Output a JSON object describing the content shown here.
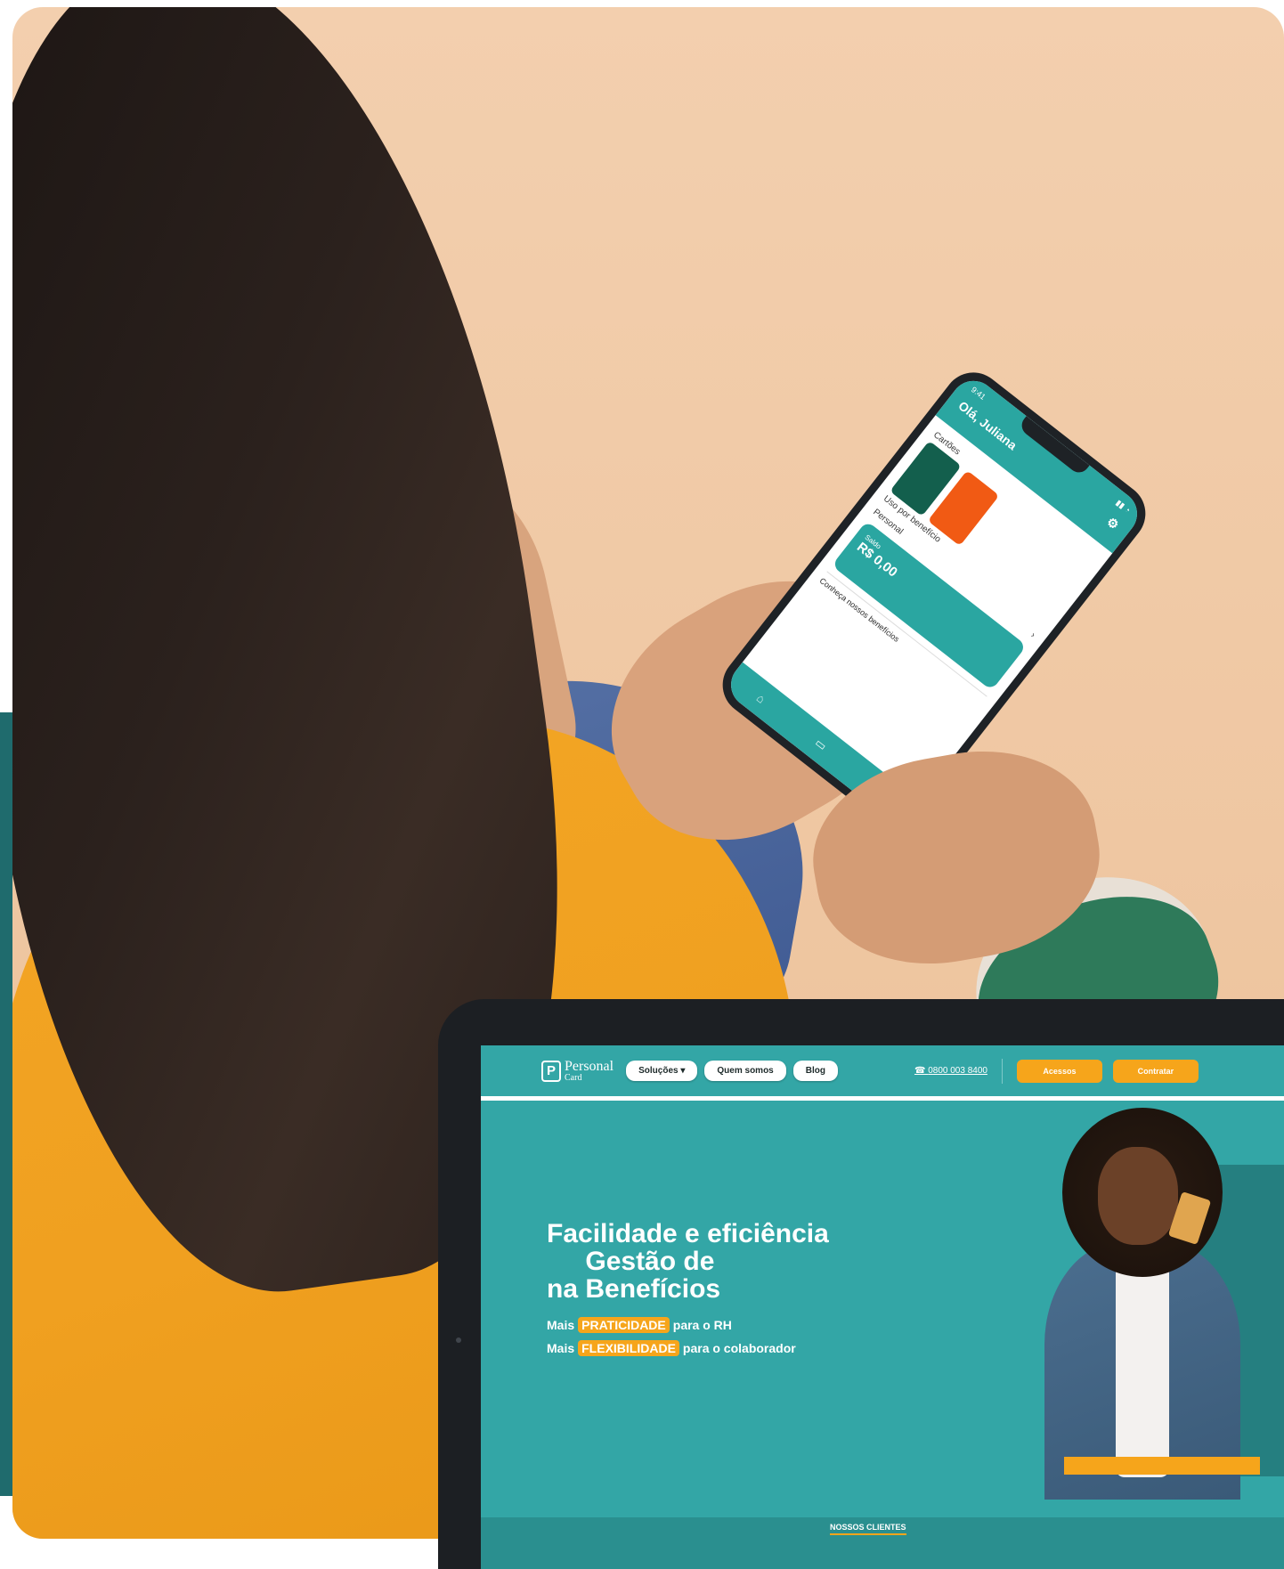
{
  "phone_app": {
    "greeting": "Olá, Juliana",
    "status_time": "9:41",
    "cards_label": "Cartões",
    "cards_caption": "Uso por benefício",
    "balance_label": "Personal",
    "balance_amount": "R$ 0,00",
    "promo_text": "Conheça nossos benefícios"
  },
  "website": {
    "logo": {
      "mark": "P",
      "line1": "Personal",
      "line2": "Card"
    },
    "nav": {
      "solucoes": "Soluções",
      "quem_somos": "Quem somos",
      "blog": "Blog",
      "phone": "0800 003 8400",
      "acessos": "Acessos",
      "contratar": "Contratar"
    },
    "hero": {
      "title_line1": "Facilidade e eficiência",
      "title_prefix": "na ",
      "title_bold": "Gestão de Benefícios",
      "line1_pre": "Mais",
      "line1_highlight": "PRATICIDADE",
      "line1_post": "para o RH",
      "line2_pre": "Mais",
      "line2_highlight": "FLEXIBILIDADE",
      "line2_post": "para o colaborador"
    },
    "clients_heading": "NOSSOS CLIENTES"
  },
  "colors": {
    "teal": "#33a6a6",
    "dark_teal": "#1f6b6d",
    "orange": "#f6a51b",
    "shirt_yellow": "#f3a625"
  },
  "icons": [
    "dropdown-chevron-icon",
    "phone-icon",
    "logo-mark-icon"
  ]
}
